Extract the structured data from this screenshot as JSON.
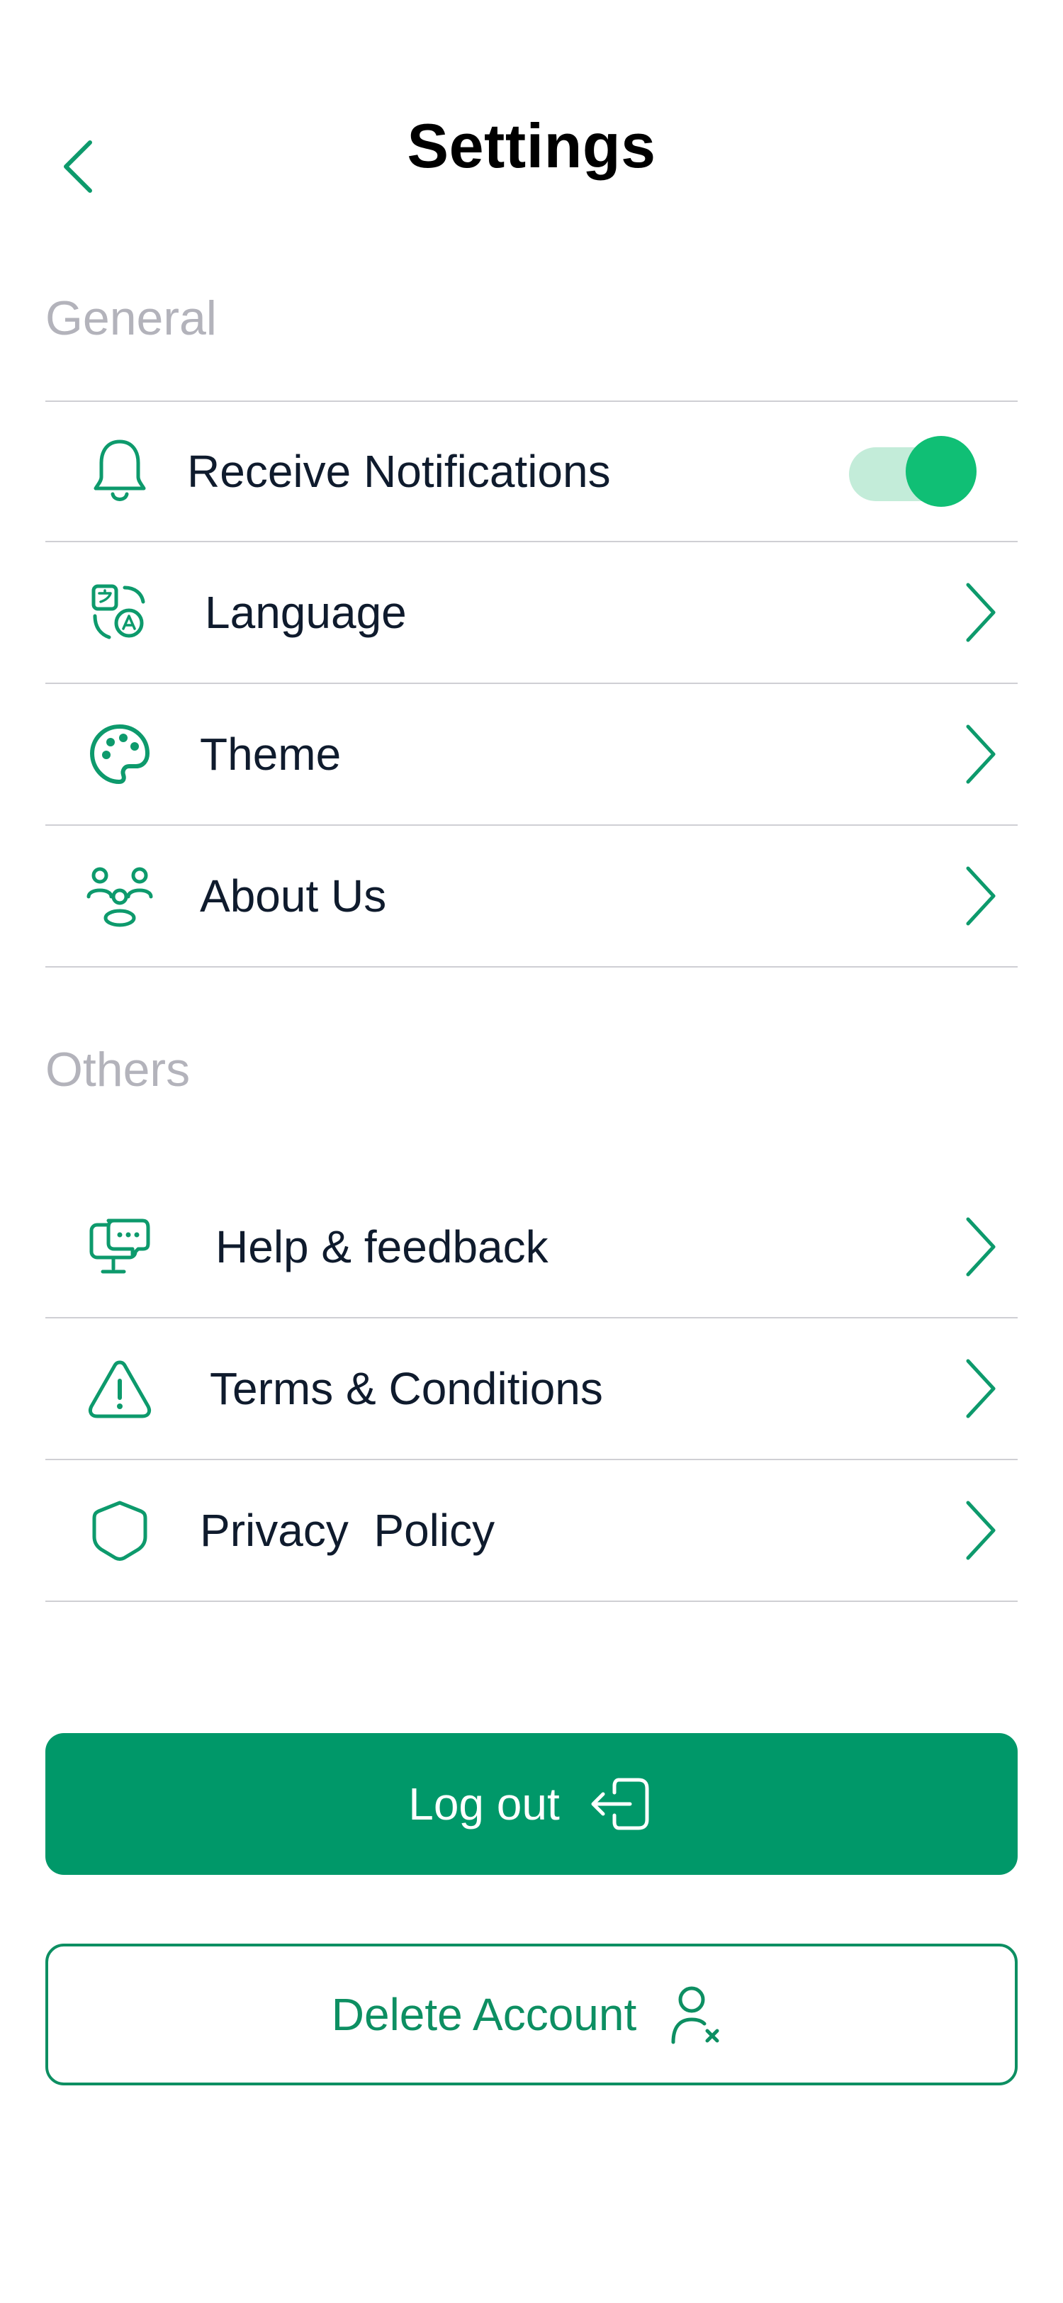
{
  "header": {
    "title": "Settings",
    "back_icon": "chevron-left-icon"
  },
  "sections": {
    "general": {
      "label": "General",
      "items": [
        {
          "label": "Receive Notifications",
          "icon": "bell-icon",
          "control": "toggle",
          "toggle_on": true
        },
        {
          "label": "Language",
          "icon": "translate-icon",
          "control": "chevron"
        },
        {
          "label": "Theme",
          "icon": "palette-icon",
          "control": "chevron"
        },
        {
          "label": "About Us",
          "icon": "people-group-icon",
          "control": "chevron"
        }
      ]
    },
    "others": {
      "label": "Others",
      "items": [
        {
          "label": "Help & feedback",
          "icon": "chat-feedback-icon",
          "control": "chevron"
        },
        {
          "label": "Terms & Conditions",
          "icon": "warning-triangle-icon",
          "control": "chevron"
        },
        {
          "label": "Privacy  Policy",
          "icon": "shield-icon",
          "control": "chevron"
        }
      ]
    }
  },
  "actions": {
    "logout_label": "Log out",
    "logout_icon": "logout-icon",
    "delete_label": "Delete Account",
    "delete_icon": "user-remove-icon"
  },
  "colors": {
    "accent": "#009869",
    "accent_bright": "#10bf75",
    "toggle_track": "#c3ecd9",
    "section_label": "#b3b3bb",
    "divider": "#cfcfd4",
    "text": "#0f1b2d"
  }
}
